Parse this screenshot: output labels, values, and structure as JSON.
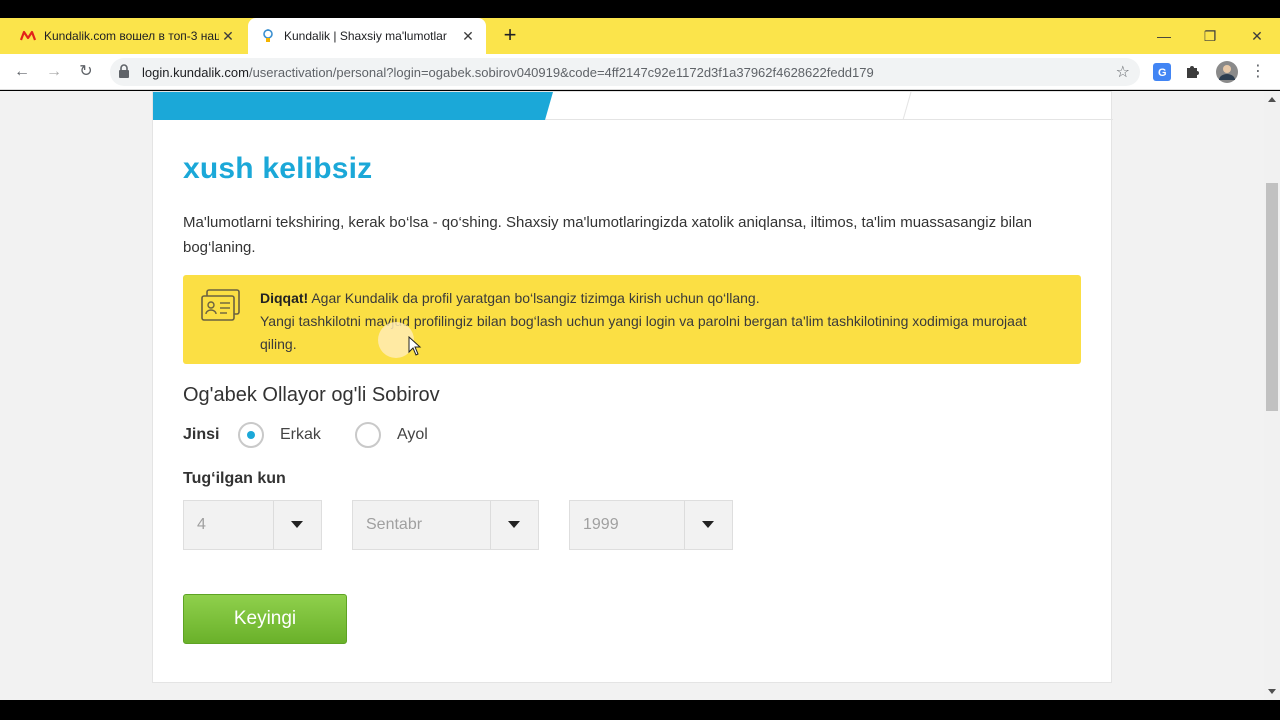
{
  "browser": {
    "tabs": [
      {
        "title": "Kundalik.com вошел в топ-3 нац",
        "active": false
      },
      {
        "title": "Kundalik | Shaxsiy ma'lumotlar",
        "active": true
      }
    ],
    "new_tab": "+",
    "window_controls": {
      "minimize": "—",
      "restore": "❐",
      "close": "✕"
    },
    "nav": {
      "back": "←",
      "forward": "→",
      "reload": "↻"
    },
    "url_host": "login.kundalik.com",
    "url_path": "/useractivation/personal?login=ogabek.sobirov040919&code=4ff2147c92e1172d3f1a37962f4628622fedd179",
    "star": "☆"
  },
  "page": {
    "welcome": "xush kelibsiz",
    "intro": "Ma'lumotlarni tekshiring, kerak bo‘lsa - qo‘shing. Shaxsiy ma'lumotlaringizda xatolik aniqlansa, iltimos, ta'lim muassasangiz bilan bog‘laning.",
    "notice": {
      "bold": "Diqqat!",
      "line1": " Agar Kundalik da profil yaratgan bo‘lsangiz tizimga kirish uchun qo‘llang.",
      "line2": "Yangi tashkilotni mavjud profilingiz bilan bog‘lash uchun yangi login va parolni bergan ta'lim tashkilotining xodimiga murojaat qiling."
    },
    "full_name": "Og'abek Ollayor og'li Sobirov",
    "gender": {
      "label": "Jinsi",
      "options": [
        "Erkak",
        "Ayol"
      ],
      "selected": "Erkak"
    },
    "birthdate": {
      "label": "Tug‘ilgan kun",
      "day": "4",
      "month": "Sentabr",
      "year": "1999"
    },
    "next_button": "Keyingi"
  },
  "colors": {
    "tabbar": "#fbe44b",
    "accent_blue": "#1ba8d8",
    "notice_yellow": "#fbdf44",
    "button_green": "#6ab12a"
  }
}
